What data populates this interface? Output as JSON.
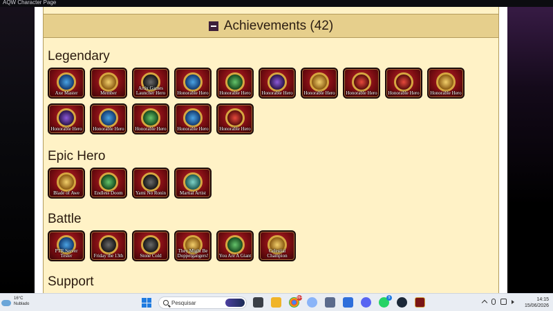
{
  "window": {
    "title": "AQW Character Page"
  },
  "achievements": {
    "title": "Achievements (42)",
    "sections": [
      {
        "name": "Legendary",
        "items": [
          {
            "label": "Axe Master",
            "color": "blue"
          },
          {
            "label": "Member",
            "color": "gold"
          },
          {
            "label": "Artix Games Launcher Hero",
            "color": "dark"
          },
          {
            "label": "Honorable Hero",
            "color": "blue"
          },
          {
            "label": "Honorable Hero",
            "color": "green"
          },
          {
            "label": "Honorable Hero",
            "color": "purple"
          },
          {
            "label": "Honorable Hero",
            "color": "gold"
          },
          {
            "label": "Honorable Hero",
            "color": "red"
          },
          {
            "label": "Honorable Hero",
            "color": "red"
          },
          {
            "label": "Honorable Hero",
            "color": "gold"
          },
          {
            "label": "Honorable Hero",
            "color": "purple"
          },
          {
            "label": "Honorable Hero",
            "color": "blue"
          },
          {
            "label": "Honorable Hero",
            "color": "green"
          },
          {
            "label": "Honorable Hero",
            "color": "blue"
          },
          {
            "label": "Honorable Hero",
            "color": "red"
          }
        ]
      },
      {
        "name": "Epic Hero",
        "items": [
          {
            "label": "Blade of Awe",
            "color": "gold"
          },
          {
            "label": "Endless Doom",
            "color": "green"
          },
          {
            "label": "Yami No Ronin",
            "color": "dark"
          },
          {
            "label": "Martial Artist",
            "color": "teal"
          }
        ]
      },
      {
        "name": "Battle",
        "items": [
          {
            "label": "PTR Server Tester",
            "color": "blue"
          },
          {
            "label": "Friday the 13th",
            "color": "dark"
          },
          {
            "label": "Stone Cold",
            "color": "dark"
          },
          {
            "label": "They Might Be Doppelgangers!",
            "color": "gold"
          },
          {
            "label": "You Are A Giant",
            "color": "green"
          },
          {
            "label": "Celestial Champion",
            "color": "gold"
          }
        ]
      },
      {
        "name": "Support",
        "items": []
      }
    ]
  },
  "taskbar": {
    "weather_temp": "16°C",
    "weather_desc": "Nublado",
    "search_placeholder": "Pesquisar",
    "badges": [
      "99+",
      "9"
    ],
    "time": "14:15",
    "date": "15/06/2026"
  }
}
